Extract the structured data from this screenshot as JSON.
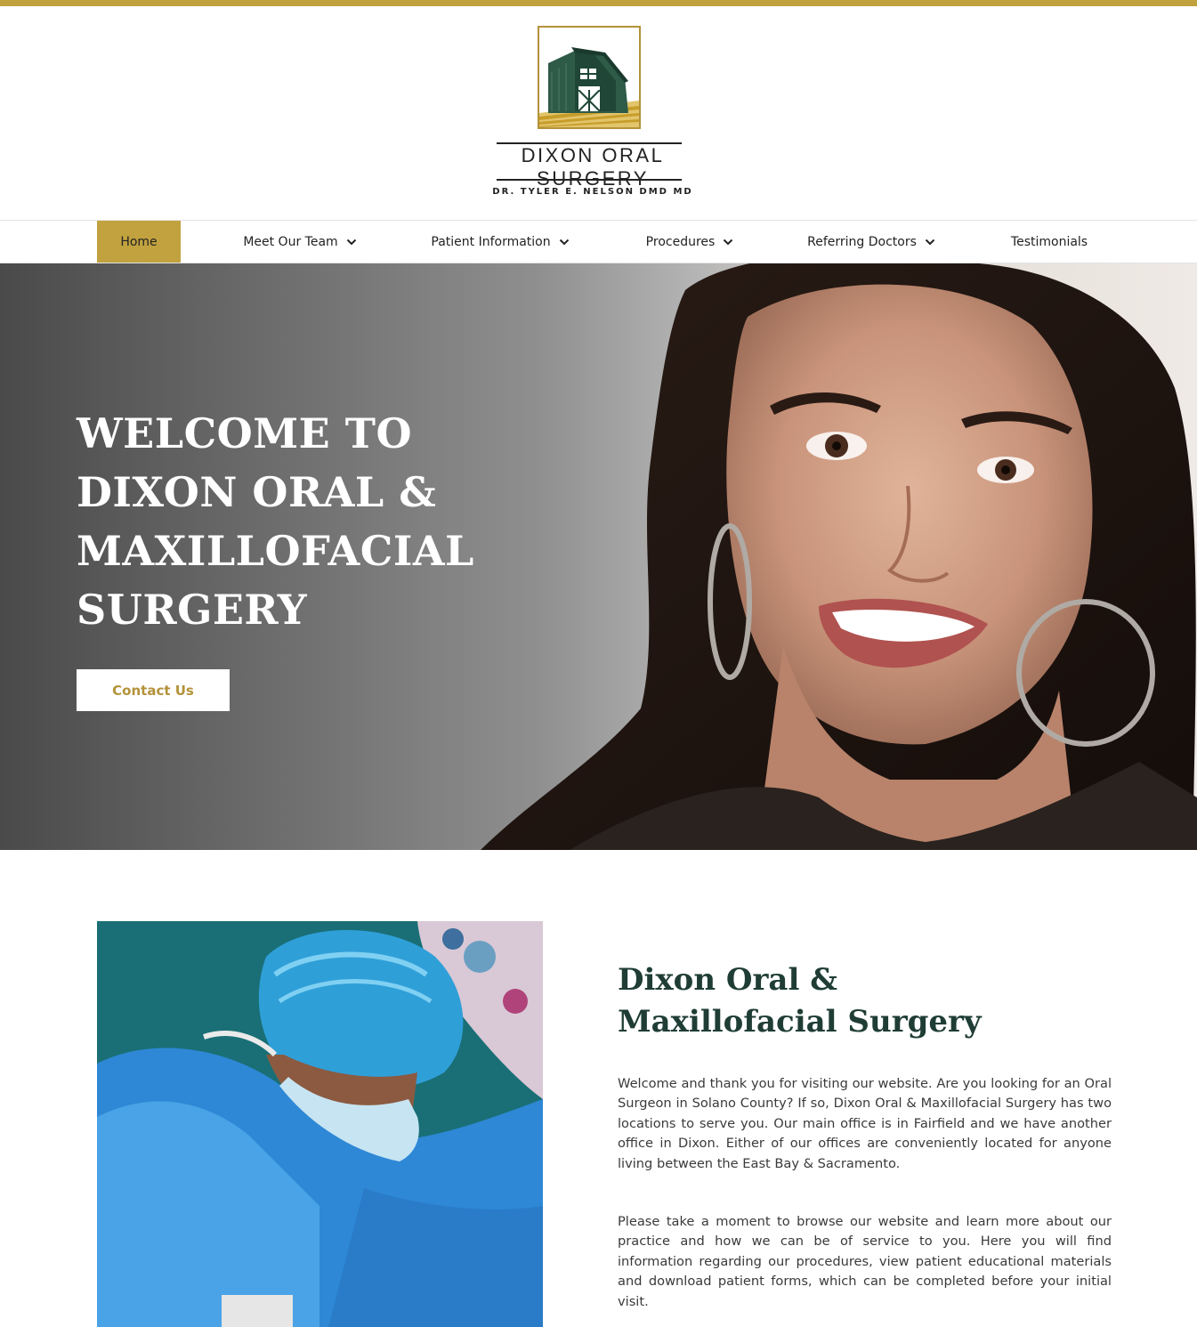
{
  "brand": {
    "name": "DIXON ORAL SURGERY",
    "subtitle": "DR. TYLER E. NELSON DMD MD",
    "accent_color": "#c2a23f",
    "heading_color": "#1f3d35",
    "logo_icon": "barn-icon"
  },
  "nav": {
    "items": [
      {
        "label": "Home",
        "dropdown": false,
        "active": true
      },
      {
        "label": "Meet Our Team",
        "dropdown": true,
        "active": false
      },
      {
        "label": "Patient Information",
        "dropdown": true,
        "active": false
      },
      {
        "label": "Procedures",
        "dropdown": true,
        "active": false
      },
      {
        "label": "Referring Doctors",
        "dropdown": true,
        "active": false
      },
      {
        "label": "Testimonials",
        "dropdown": false,
        "active": false
      }
    ]
  },
  "hero": {
    "title_lines": [
      "WELCOME TO",
      "DIXON ORAL &",
      "MAXILLOFACIAL",
      "SURGERY"
    ],
    "button_label": "Contact Us"
  },
  "about": {
    "title_lines": [
      "Dixon Oral &",
      "Maxillofacial Surgery"
    ],
    "paragraphs": [
      "Welcome and thank you for visiting our website. Are you looking for an Oral Surgeon in Solano County? If so, Dixon Oral & Maxillofacial Surgery has two locations to serve you. Our main office is in Fairfield and we have another office in Dixon. Either of our offices are conveniently located for anyone living between the East Bay & Sacramento.",
      "Please take a moment to browse our website and learn more about our practice and how we can be of service to you. Here you will find information regarding our procedures, view patient educational materials and download patient forms, which can be completed before your initial visit."
    ]
  }
}
